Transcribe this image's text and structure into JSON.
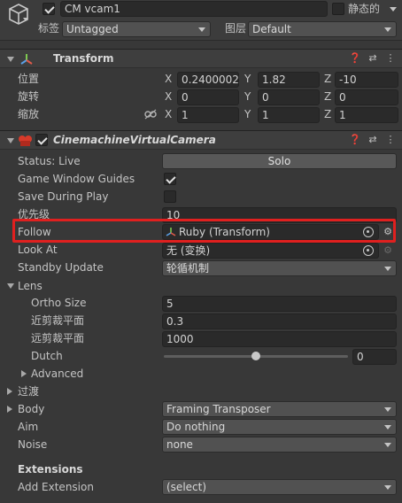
{
  "gameobject": {
    "active": true,
    "name": "CM vcam1",
    "static_label": "静态的",
    "static_checked": false,
    "tag_label": "标签",
    "tag_value": "Untagged",
    "layer_label": "图层",
    "layer_value": "Default"
  },
  "transform": {
    "title": "Transform",
    "position_label": "位置",
    "rotation_label": "旋转",
    "scale_label": "缩放",
    "position": {
      "x": "0.2400002",
      "y": "1.82",
      "z": "-10"
    },
    "rotation": {
      "x": "0",
      "y": "0",
      "z": "0"
    },
    "scale": {
      "x": "1",
      "y": "1",
      "z": "1"
    },
    "axis_x": "X",
    "axis_y": "Y",
    "axis_z": "Z"
  },
  "vcam": {
    "title": "CinemachineVirtualCamera",
    "enabled": true,
    "status_label": "Status: Live",
    "solo_label": "Solo",
    "game_window_guides_label": "Game Window Guides",
    "game_window_guides_checked": true,
    "save_during_play_label": "Save During Play",
    "save_during_play_checked": false,
    "priority_label": "优先级",
    "priority_value": "10",
    "follow_label": "Follow",
    "follow_value": "Ruby (Transform)",
    "lookat_label": "Look At",
    "lookat_value": "无 (变换)",
    "standby_label": "Standby Update",
    "standby_value": "轮循机制",
    "lens_label": "Lens",
    "ortho_label": "Ortho Size",
    "ortho_value": "5",
    "near_label": "近剪裁平面",
    "near_value": "0.3",
    "far_label": "远剪裁平面",
    "far_value": "1000",
    "dutch_label": "Dutch",
    "dutch_value": "0",
    "dutch_fraction": 0.5,
    "advanced_label": "Advanced",
    "transition_label": "过渡",
    "body_label": "Body",
    "body_value": "Framing Transposer",
    "aim_label": "Aim",
    "aim_value": "Do nothing",
    "noise_label": "Noise",
    "noise_value": "none",
    "extensions_label": "Extensions",
    "add_extension_label": "Add Extension",
    "add_extension_value": "(select)"
  },
  "colors": {
    "highlight": "#e0201f",
    "background": "#383838"
  }
}
